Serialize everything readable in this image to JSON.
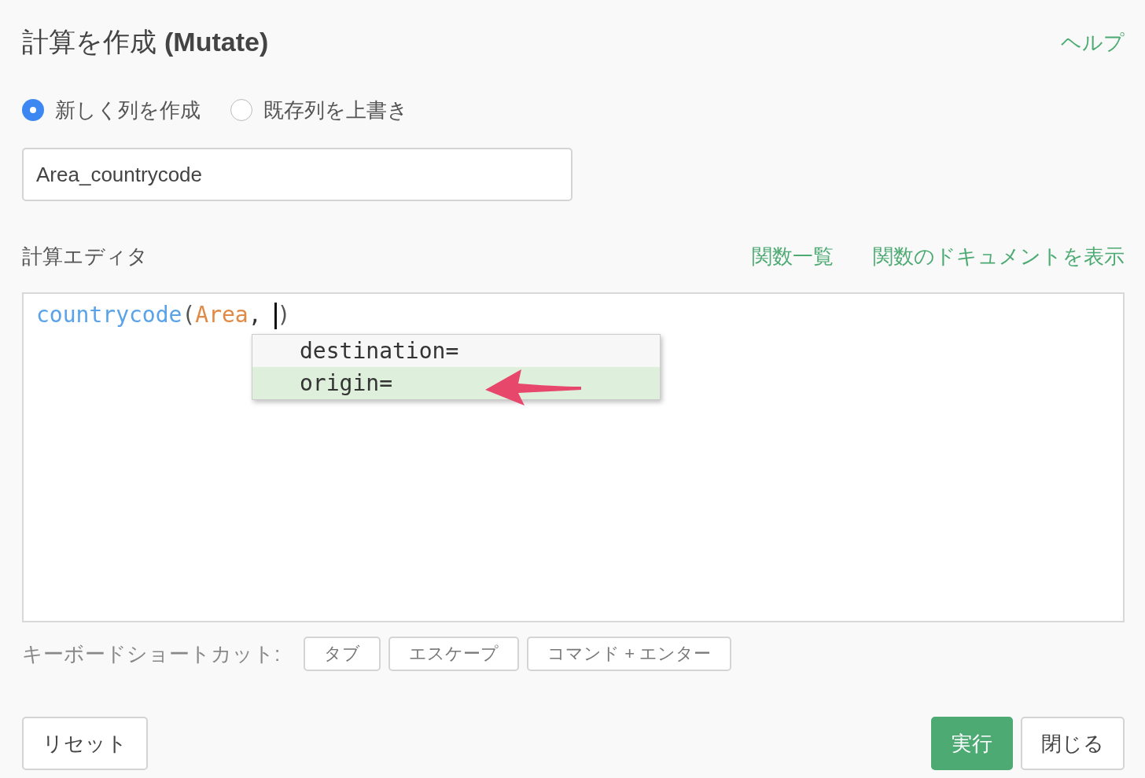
{
  "title": "計算を作成",
  "title_suffix": "(Mutate)",
  "help_link": "ヘルプ",
  "radios": [
    {
      "label": "新しく列を作成",
      "selected": true
    },
    {
      "label": "既存列を上書き",
      "selected": false
    }
  ],
  "column_name": {
    "value": "Area_countrycode"
  },
  "editor": {
    "label": "計算エディタ",
    "links": [
      "関数一覧",
      "関数のドキュメントを表示"
    ],
    "code_before_cursor": [
      {
        "kind": "function",
        "text": "countrycode"
      },
      {
        "kind": "punct",
        "text": "("
      },
      {
        "kind": "arg",
        "text": "Area"
      },
      {
        "kind": "plain",
        "text": ", "
      }
    ],
    "code_after_cursor": [
      {
        "kind": "punct",
        "text": ")"
      }
    ],
    "suggestions": [
      {
        "text": "destination=",
        "selected": false
      },
      {
        "text": "origin=",
        "selected": true
      }
    ]
  },
  "shortcuts": {
    "label": "キーボードショートカット:",
    "keys": [
      "タブ",
      "エスケープ",
      "コマンド + エンター"
    ]
  },
  "buttons": {
    "reset": "リセット",
    "run": "実行",
    "close": "閉じる"
  }
}
